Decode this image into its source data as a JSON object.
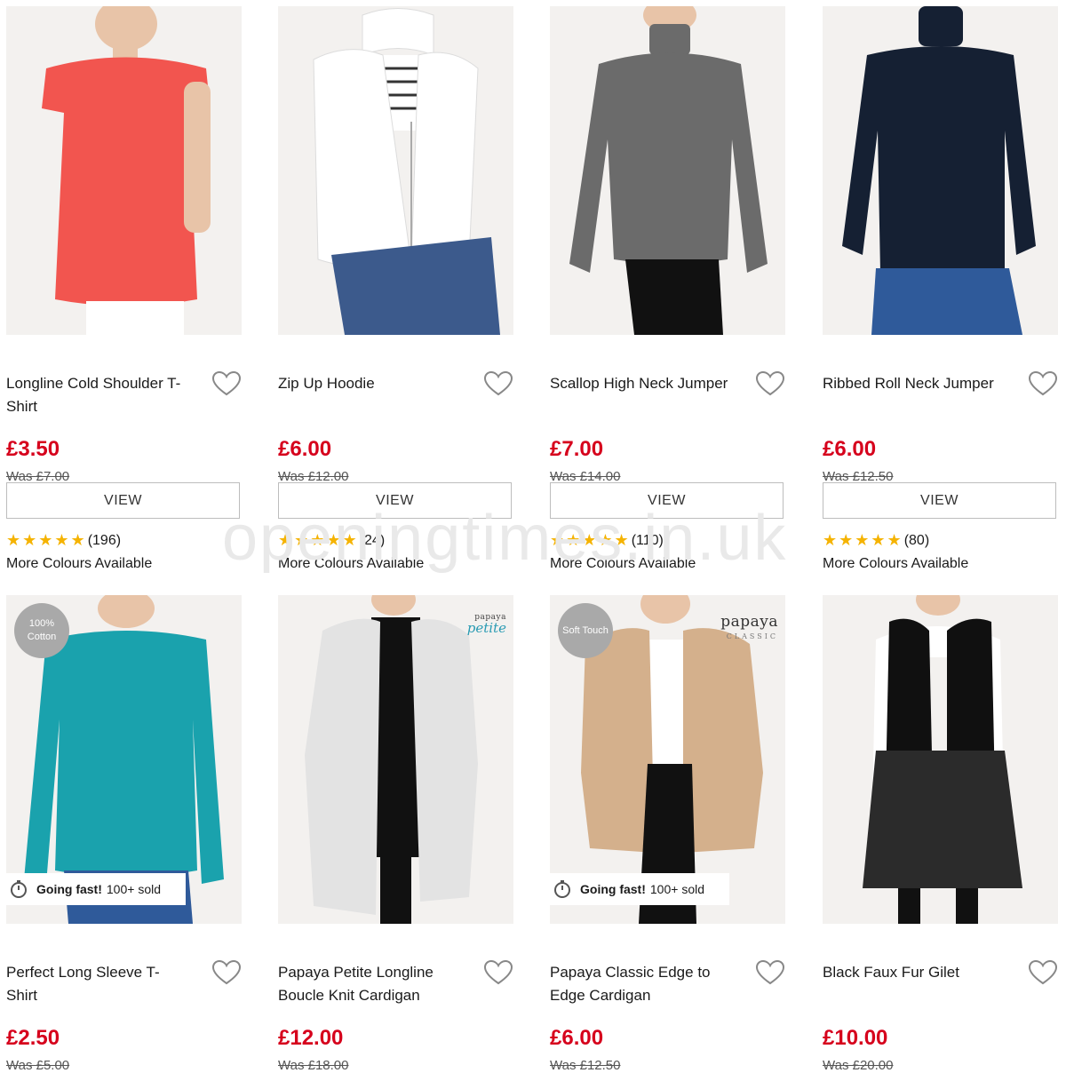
{
  "watermark": "openingtimes.in.uk",
  "products": [
    {
      "name": "Longline Cold Shoulder T-Shirt",
      "price": "£3.50",
      "was": "Was £7.00",
      "view": "VIEW",
      "stars": "★★★★★",
      "reviews": "(196)",
      "colours": "More Colours Available",
      "badge": "",
      "brand1": "",
      "brand2": "",
      "fast_bold": "",
      "fast_text": ""
    },
    {
      "name": "Zip Up Hoodie",
      "price": "£6.00",
      "was": "Was £12.00",
      "view": "VIEW",
      "stars": "★★★★★",
      "reviews": "(24)",
      "colours": "More Colours Available",
      "badge": "",
      "brand1": "",
      "brand2": "",
      "fast_bold": "",
      "fast_text": ""
    },
    {
      "name": "Scallop High Neck Jumper",
      "price": "£7.00",
      "was": "Was £14.00",
      "view": "VIEW",
      "stars": "★★★★★",
      "reviews": "(110)",
      "colours": "More Colours Available",
      "badge": "",
      "brand1": "",
      "brand2": "",
      "fast_bold": "",
      "fast_text": ""
    },
    {
      "name": "Ribbed Roll Neck Jumper",
      "price": "£6.00",
      "was": "Was £12.50",
      "view": "VIEW",
      "stars": "★★★★★",
      "reviews": "(80)",
      "colours": "More Colours Available",
      "badge": "",
      "brand1": "",
      "brand2": "",
      "fast_bold": "",
      "fast_text": ""
    },
    {
      "name": "Perfect Long Sleeve T-Shirt",
      "price": "£2.50",
      "was": "Was £5.00",
      "badge": "100% Cotton",
      "brand1": "",
      "brand2": "",
      "fast_bold": "Going fast!",
      "fast_text": "100+ sold"
    },
    {
      "name": "Papaya Petite Longline Boucle Knit Cardigan",
      "price": "£12.00",
      "was": "Was £18.00",
      "badge": "",
      "brand1": "papaya",
      "brand2": "petite",
      "fast_bold": "",
      "fast_text": ""
    },
    {
      "name": "Papaya Classic Edge to Edge Cardigan",
      "price": "£6.00",
      "was": "Was £12.50",
      "badge": "Soft Touch",
      "brand1": "papaya",
      "brand2": "CLASSIC",
      "fast_bold": "Going fast!",
      "fast_text": "100+ sold"
    },
    {
      "name": "Black Faux Fur Gilet",
      "price": "£10.00",
      "was": "Was £20.00",
      "badge": "",
      "brand1": "",
      "brand2": "",
      "fast_bold": "",
      "fast_text": ""
    }
  ],
  "icons": {
    "wishlist": "heart-outline-icon",
    "rating": "star-icon",
    "urgency": "stopwatch-icon"
  },
  "colors": {
    "price": "#d6001c",
    "stars": "#f5b301",
    "garments": [
      "#f2554f",
      "#ffffff",
      "#6b6b6b",
      "#152033",
      "#1aa2ad",
      "#e3e3e3",
      "#d4b08c",
      "#101010"
    ]
  }
}
